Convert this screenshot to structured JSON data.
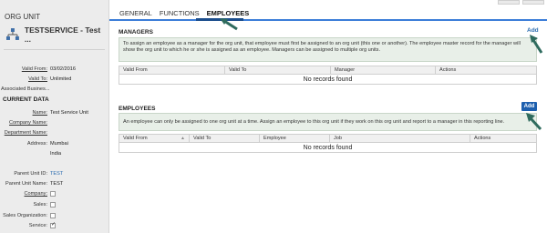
{
  "left": {
    "header": "ORG UNIT",
    "org_title": "TESTSERVICE - Test ...",
    "valid_from_label": "Valid From:",
    "valid_from_value": "03/02/2016",
    "valid_to_label": "Valid To:",
    "valid_to_value": "Unlimited",
    "assoc_label": "Associated Busines...",
    "current_data_title": "CURRENT DATA",
    "name_label": "Name:",
    "name_value": "Test Service Unit",
    "company_name_label": "Company Name:",
    "department_name_label": "Department Name:",
    "address_label": "Address:",
    "address_line1": "Mumbai",
    "address_line2": "India",
    "parent_unit_id_label": "Parent Unit ID:",
    "parent_unit_id_value": "TEST",
    "parent_unit_name_label": "Parent Unit Name:",
    "parent_unit_name_value": "TEST",
    "company_label": "Company:",
    "sales_label": "Sales:",
    "sales_org_label": "Sales Organization:",
    "service_label": "Service:"
  },
  "tabs": [
    "GENERAL",
    "FUNCTIONS",
    "EMPLOYEES"
  ],
  "managers": {
    "title": "MANAGERS",
    "add_label": "Add",
    "info": "To assign an employee as a manager for the org unit, that employee must first be assigned to an org unit (this one or another). The employee master record for the manager will show the org unit to which he or she is assigned as an employee. Managers can be assigned to multiple org units.",
    "columns": [
      "Valid From",
      "Valid To",
      "Manager",
      "Actions"
    ],
    "empty": "No records found"
  },
  "employees": {
    "title": "EMPLOYEES",
    "add_label": "Add",
    "info": "An employee can only be assigned to one org unit at a time.  Assign an employee to this org unit if they work on this org unit and report to a manager in this reporting line.",
    "columns": [
      "Valid From",
      "Valid To",
      "Employee",
      "Job",
      "Actions"
    ],
    "empty": "No records found"
  },
  "colors": {
    "accent": "#3b7dd8",
    "add_button": "#1d5fae",
    "arrow": "#2f6b5e",
    "info_bg": "#e8efe8"
  },
  "checkboxes": {
    "company": false,
    "sales": false,
    "sales_organization": false,
    "service": true
  }
}
